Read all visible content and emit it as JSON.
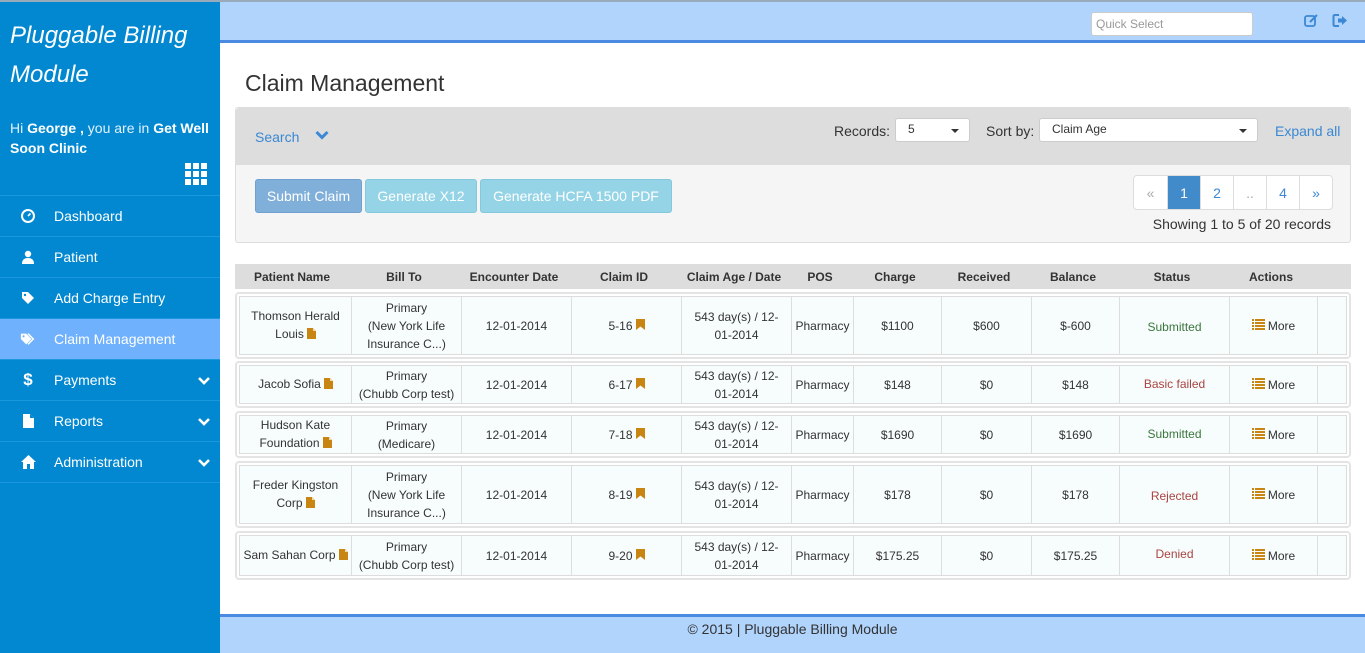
{
  "app": {
    "brand": "Pluggable Billing Module",
    "greeting": {
      "prefix": "Hi ",
      "user": "George ,",
      "middle": " you are in ",
      "clinic": "Get Well Soon Clinic"
    }
  },
  "sidebar": {
    "items": [
      {
        "label": "Dashboard",
        "icon": "dashboard-icon",
        "active": false,
        "expandable": false
      },
      {
        "label": "Patient",
        "icon": "user-icon",
        "active": false,
        "expandable": false
      },
      {
        "label": "Add Charge Entry",
        "icon": "tag-icon",
        "active": false,
        "expandable": false
      },
      {
        "label": "Claim Management",
        "icon": "tags-icon",
        "active": true,
        "expandable": false
      },
      {
        "label": "Payments",
        "icon": "dollar-icon",
        "active": false,
        "expandable": true
      },
      {
        "label": "Reports",
        "icon": "file-icon",
        "active": false,
        "expandable": true
      },
      {
        "label": "Administration",
        "icon": "home-icon",
        "active": false,
        "expandable": true
      }
    ]
  },
  "topbar": {
    "quick_select_placeholder": "Quick Select",
    "icons": [
      "edit-icon",
      "logout-icon"
    ]
  },
  "page": {
    "title": "Claim Management",
    "search_label": "Search",
    "records_label": "Records:",
    "records_value": "5",
    "sort_label": "Sort by:",
    "sort_value": "Claim Age",
    "expand_all": "Expand all",
    "buttons": {
      "submit": "Submit Claim",
      "x12": "Generate X12",
      "hcfa": "Generate HCFA 1500 PDF"
    },
    "pagination": {
      "prev": "«",
      "pages": [
        "1",
        "2",
        "..",
        "4"
      ],
      "active": "1",
      "next": "»"
    },
    "showing": "Showing 1 to 5 of 20 records"
  },
  "table": {
    "headers": [
      "Patient Name",
      "Bill To",
      "Encounter Date",
      "Claim ID",
      "Claim Age / Date",
      "POS",
      "Charge",
      "Received",
      "Balance",
      "Status",
      "Actions"
    ],
    "rows": [
      {
        "patient": "Thomson Herald Louis",
        "bill_to_type": "Primary",
        "bill_to_payer": "(New York Life Insurance C...)",
        "encounter_date": "12-01-2014",
        "claim_id": "5-16",
        "claim_age": "543 day(s) / 12-01-2014",
        "pos": "Pharmacy",
        "charge": "$1100",
        "received": "$600",
        "balance": "$-600",
        "status": "Submitted",
        "status_color": "#3c763d",
        "action": "More"
      },
      {
        "patient": "Jacob Sofia",
        "bill_to_type": "Primary",
        "bill_to_payer": "(Chubb Corp test)",
        "encounter_date": "12-01-2014",
        "claim_id": "6-17",
        "claim_age": "543 day(s) / 12-01-2014",
        "pos": "Pharmacy",
        "charge": "$148",
        "received": "$0",
        "balance": "$148",
        "status": "Basic failed",
        "status_color": "#a94442",
        "action": "More"
      },
      {
        "patient": "Hudson Kate Foundation",
        "bill_to_type": "Primary",
        "bill_to_payer": "(Medicare)",
        "encounter_date": "12-01-2014",
        "claim_id": "7-18",
        "claim_age": "543 day(s) / 12-01-2014",
        "pos": "Pharmacy",
        "charge": "$1690",
        "received": "$0",
        "balance": "$1690",
        "status": "Submitted",
        "status_color": "#3c763d",
        "action": "More"
      },
      {
        "patient": "Freder Kingston Corp",
        "bill_to_type": "Primary",
        "bill_to_payer": "(New York Life Insurance C...)",
        "encounter_date": "12-01-2014",
        "claim_id": "8-19",
        "claim_age": "543 day(s) / 12-01-2014",
        "pos": "Pharmacy",
        "charge": "$178",
        "received": "$0",
        "balance": "$178",
        "status": "Rejected",
        "status_color": "#a94442",
        "action": "More"
      },
      {
        "patient": "Sam Sahan Corp",
        "bill_to_type": "Primary",
        "bill_to_payer": "(Chubb Corp test)",
        "encounter_date": "12-01-2014",
        "claim_id": "9-20",
        "claim_age": "543 day(s) / 12-01-2014",
        "pos": "Pharmacy",
        "charge": "$175.25",
        "received": "$0",
        "balance": "$175.25",
        "status": "Denied",
        "status_color": "#a94442",
        "action": "More"
      }
    ]
  },
  "footer": {
    "text": "© 2015 | Pluggable Billing Module"
  },
  "colors": {
    "sidebar": "#0288d1",
    "sidebar_active": "#6fb1fc",
    "topbar": "#b0d4fc",
    "accent": "#4a8ae0",
    "icon_orange": "#c98512"
  }
}
